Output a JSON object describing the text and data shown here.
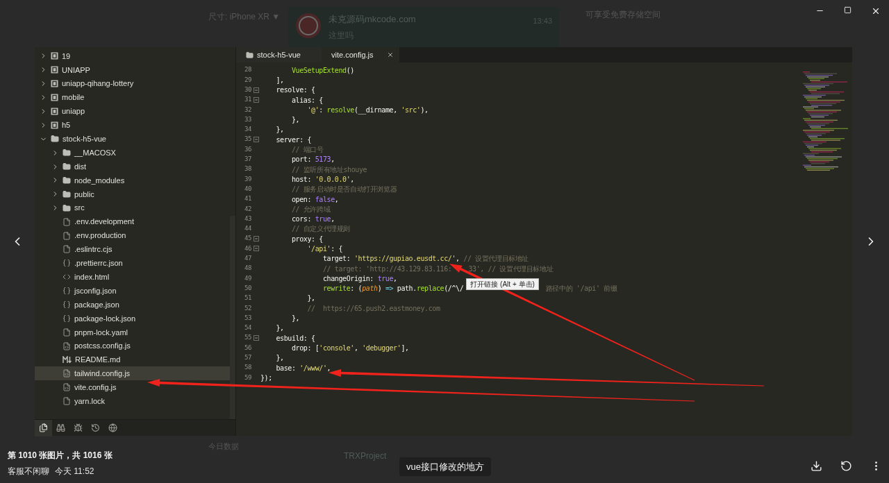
{
  "backdrop": {
    "size_selector": "尺寸: iPhone XR ▼",
    "chat_card": {
      "name": "未克源码mkcode.com",
      "message": "这里吗",
      "time": "13:43"
    },
    "notice": "可享受免费存储空间",
    "section_title": "今日数据",
    "bottom_chat_name": "TRXProject"
  },
  "editor": {
    "sidebar": {
      "tree": [
        {
          "label": "19",
          "kind": "project",
          "expanded": false,
          "selected": false
        },
        {
          "label": "UNIAPP",
          "kind": "project",
          "expanded": false,
          "selected": false
        },
        {
          "label": "uniapp-qihang-lottery",
          "kind": "project",
          "expanded": false,
          "selected": false
        },
        {
          "label": "mobile",
          "kind": "project",
          "expanded": false,
          "selected": false
        },
        {
          "label": "uniapp",
          "kind": "project",
          "expanded": false,
          "selected": false
        },
        {
          "label": "h5",
          "kind": "project",
          "expanded": false,
          "selected": false
        },
        {
          "label": "stock-h5-vue",
          "kind": "folder",
          "expanded": true,
          "selected": false,
          "children": [
            {
              "label": "__MACOSX",
              "kind": "folder",
              "expanded": false,
              "selected": false
            },
            {
              "label": "dist",
              "kind": "folder",
              "expanded": false,
              "selected": false
            },
            {
              "label": "node_modules",
              "kind": "folder",
              "expanded": false,
              "selected": false
            },
            {
              "label": "public",
              "kind": "folder",
              "expanded": false,
              "selected": false
            },
            {
              "label": "src",
              "kind": "folder",
              "expanded": false,
              "selected": false
            },
            {
              "label": ".env.development",
              "kind": "file",
              "selected": false
            },
            {
              "label": ".env.production",
              "kind": "file",
              "selected": false
            },
            {
              "label": ".eslintrc.cjs",
              "kind": "file",
              "selected": false
            },
            {
              "label": ".prettierrc.json",
              "kind": "json",
              "selected": false
            },
            {
              "label": "index.html",
              "kind": "html",
              "selected": false
            },
            {
              "label": "jsconfig.json",
              "kind": "json",
              "selected": false
            },
            {
              "label": "package.json",
              "kind": "json",
              "selected": false
            },
            {
              "label": "package-lock.json",
              "kind": "json",
              "selected": false
            },
            {
              "label": "pnpm-lock.yaml",
              "kind": "file",
              "selected": false
            },
            {
              "label": "postcss.config.js",
              "kind": "script",
              "selected": false
            },
            {
              "label": "README.md",
              "kind": "markdown",
              "selected": false
            },
            {
              "label": "tailwind.config.js",
              "kind": "script",
              "selected": true
            },
            {
              "label": "vite.config.js",
              "kind": "script",
              "selected": false
            },
            {
              "label": "yarn.lock",
              "kind": "file",
              "selected": false
            }
          ]
        }
      ],
      "toolbar": [
        {
          "kind": "explorer",
          "selected": true
        },
        {
          "kind": "search",
          "selected": false
        },
        {
          "kind": "debug",
          "selected": false
        },
        {
          "kind": "history",
          "selected": false
        },
        {
          "kind": "browser",
          "selected": false
        }
      ]
    },
    "tabs": [
      {
        "label": "stock-h5-vue",
        "kind": "folder",
        "selected": false
      },
      {
        "label": "vite.config.js",
        "kind": "file",
        "selected": true
      }
    ],
    "lines": [
      {
        "number": "28",
        "fold": false,
        "parts": [
          "        VueSetupExtend()"
        ]
      },
      {
        "number": "29",
        "fold": false,
        "parts": [
          "    ],"
        ]
      },
      {
        "number": "30",
        "fold": true,
        "parts": [
          "    resolve: {"
        ]
      },
      {
        "number": "31",
        "fold": true,
        "parts": [
          "        alias: {"
        ]
      },
      {
        "number": "32",
        "fold": false,
        "parts": [
          "            '@': resolve(__dirname, 'src'),"
        ]
      },
      {
        "number": "33",
        "fold": false,
        "parts": [
          "        },"
        ]
      },
      {
        "number": "34",
        "fold": false,
        "parts": [
          "    },"
        ]
      },
      {
        "number": "35",
        "fold": true,
        "parts": [
          "    server: {"
        ]
      },
      {
        "number": "36",
        "fold": false,
        "parts": [
          "        // 端口号"
        ]
      },
      {
        "number": "37",
        "fold": false,
        "parts": [
          "        port: 5173,"
        ]
      },
      {
        "number": "38",
        "fold": false,
        "parts": [
          "        // 监听所有地址shouye"
        ]
      },
      {
        "number": "39",
        "fold": false,
        "parts": [
          "        host: '0.0.0.0',"
        ]
      },
      {
        "number": "40",
        "fold": false,
        "parts": [
          "        // 服务启动时是否自动打开浏览器"
        ]
      },
      {
        "number": "41",
        "fold": false,
        "parts": [
          "        open: false,"
        ]
      },
      {
        "number": "42",
        "fold": false,
        "parts": [
          "        // 允许跨域"
        ]
      },
      {
        "number": "43",
        "fold": false,
        "parts": [
          "        cors: true,"
        ]
      },
      {
        "number": "44",
        "fold": false,
        "parts": [
          "        // 自定义代理规则"
        ]
      },
      {
        "number": "45",
        "fold": true,
        "parts": [
          "        proxy: {"
        ]
      },
      {
        "number": "46",
        "fold": true,
        "parts": [
          "            '/api': {"
        ]
      },
      {
        "number": "47",
        "fold": false,
        "parts": [
          "                target: 'https://gupiao.eusdt.cc/', // 设置代理目标地址"
        ]
      },
      {
        "number": "48",
        "fold": false,
        "parts": [
          "                // target: 'http://43.129.83.116:",
          "33', // 设置代理目标地址"
        ]
      },
      {
        "number": "49",
        "fold": false,
        "parts": [
          "                changeOrigin: true,"
        ]
      },
      {
        "number": "50",
        "fold": false,
        "parts": [
          "                rewrite: (path) => path.replace(/^\\/",
          "路径中的 '/api' 前缀"
        ],
        "tooltip": "打开链接 (Alt + 单击)"
      },
      {
        "number": "51",
        "fold": false,
        "parts": [
          "            },"
        ]
      },
      {
        "number": "52",
        "fold": false,
        "parts": [
          "            //  https://65.push2.eastmoney.com"
        ]
      },
      {
        "number": "53",
        "fold": false,
        "parts": [
          "        },"
        ]
      },
      {
        "number": "54",
        "fold": false,
        "parts": [
          "    },"
        ]
      },
      {
        "number": "55",
        "fold": true,
        "parts": [
          "    esbuild: {"
        ]
      },
      {
        "number": "56",
        "fold": false,
        "parts": [
          "        drop: ['console', 'debugger'],"
        ]
      },
      {
        "number": "57",
        "fold": false,
        "parts": [
          "    },"
        ]
      },
      {
        "number": "58",
        "fold": false,
        "parts": [
          "    base: '/www/',"
        ]
      },
      {
        "number": "59",
        "fold": false,
        "parts": [
          "});"
        ]
      }
    ]
  },
  "viewer": {
    "counter": "第 1010 张图片，共 1016 张",
    "sender": "客服不闲聊",
    "time": "今天 11:52",
    "caption": "vue接口修改的地方"
  }
}
